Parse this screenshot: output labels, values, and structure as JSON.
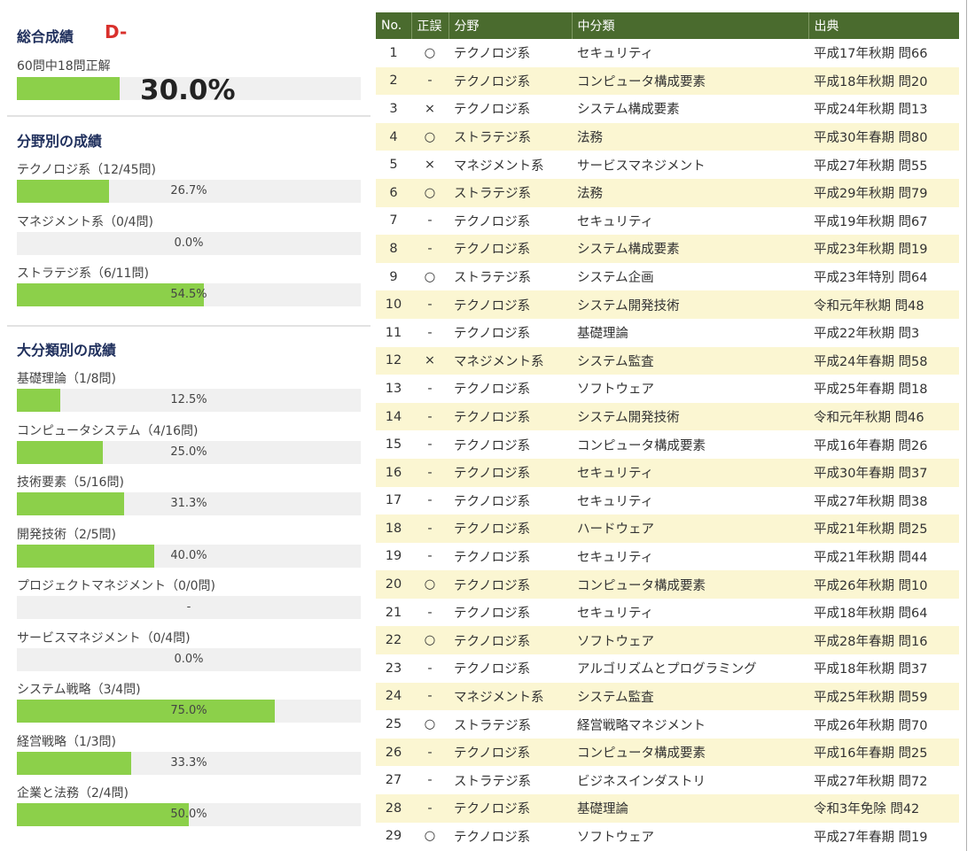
{
  "summary": {
    "title": "総合成績",
    "grade": "D-",
    "count_text": "60問中18問正解",
    "percent": "30.0%",
    "ratio": 0.3
  },
  "field_section": {
    "title": "分野別の成績",
    "items": [
      {
        "label": "テクノロジ系（12/45問)",
        "percent": "26.7%",
        "ratio": 0.267
      },
      {
        "label": "マネジメント系（0/4問)",
        "percent": "0.0%",
        "ratio": 0.0
      },
      {
        "label": "ストラテジ系（6/11問)",
        "percent": "54.5%",
        "ratio": 0.545
      }
    ]
  },
  "category_section": {
    "title": "大分類別の成績",
    "items": [
      {
        "label": "基礎理論（1/8問)",
        "percent": "12.5%",
        "ratio": 0.125
      },
      {
        "label": "コンピュータシステム（4/16問)",
        "percent": "25.0%",
        "ratio": 0.25
      },
      {
        "label": "技術要素（5/16問)",
        "percent": "31.3%",
        "ratio": 0.313
      },
      {
        "label": "開発技術（2/5問)",
        "percent": "40.0%",
        "ratio": 0.4
      },
      {
        "label": "プロジェクトマネジメント（0/0問)",
        "percent": "-",
        "ratio": 0.0
      },
      {
        "label": "サービスマネジメント（0/4問)",
        "percent": "0.0%",
        "ratio": 0.0
      },
      {
        "label": "システム戦略（3/4問)",
        "percent": "75.0%",
        "ratio": 0.75
      },
      {
        "label": "経営戦略（1/3問)",
        "percent": "33.3%",
        "ratio": 0.333
      },
      {
        "label": "企業と法務（2/4問)",
        "percent": "50.0%",
        "ratio": 0.5
      }
    ]
  },
  "table": {
    "headers": [
      "No.",
      "正誤",
      "分野",
      "中分類",
      "出典"
    ],
    "rows": [
      [
        "1",
        "○",
        "テクノロジ系",
        "セキュリティ",
        "平成17年秋期 問66"
      ],
      [
        "2",
        "-",
        "テクノロジ系",
        "コンピュータ構成要素",
        "平成18年秋期 問20"
      ],
      [
        "3",
        "×",
        "テクノロジ系",
        "システム構成要素",
        "平成24年秋期 問13"
      ],
      [
        "4",
        "○",
        "ストラテジ系",
        "法務",
        "平成30年春期 問80"
      ],
      [
        "5",
        "×",
        "マネジメント系",
        "サービスマネジメント",
        "平成27年秋期 問55"
      ],
      [
        "6",
        "○",
        "ストラテジ系",
        "法務",
        "平成29年秋期 問79"
      ],
      [
        "7",
        "-",
        "テクノロジ系",
        "セキュリティ",
        "平成19年秋期 問67"
      ],
      [
        "8",
        "-",
        "テクノロジ系",
        "システム構成要素",
        "平成23年秋期 問19"
      ],
      [
        "9",
        "○",
        "ストラテジ系",
        "システム企画",
        "平成23年特別 問64"
      ],
      [
        "10",
        "-",
        "テクノロジ系",
        "システム開発技術",
        "令和元年秋期 問48"
      ],
      [
        "11",
        "-",
        "テクノロジ系",
        "基礎理論",
        "平成22年秋期 問3"
      ],
      [
        "12",
        "×",
        "マネジメント系",
        "システム監査",
        "平成24年春期 問58"
      ],
      [
        "13",
        "-",
        "テクノロジ系",
        "ソフトウェア",
        "平成25年春期 問18"
      ],
      [
        "14",
        "-",
        "テクノロジ系",
        "システム開発技術",
        "令和元年秋期 問46"
      ],
      [
        "15",
        "-",
        "テクノロジ系",
        "コンピュータ構成要素",
        "平成16年春期 問26"
      ],
      [
        "16",
        "-",
        "テクノロジ系",
        "セキュリティ",
        "平成30年春期 問37"
      ],
      [
        "17",
        "-",
        "テクノロジ系",
        "セキュリティ",
        "平成27年秋期 問38"
      ],
      [
        "18",
        "-",
        "テクノロジ系",
        "ハードウェア",
        "平成21年秋期 問25"
      ],
      [
        "19",
        "-",
        "テクノロジ系",
        "セキュリティ",
        "平成21年秋期 問44"
      ],
      [
        "20",
        "○",
        "テクノロジ系",
        "コンピュータ構成要素",
        "平成26年秋期 問10"
      ],
      [
        "21",
        "-",
        "テクノロジ系",
        "セキュリティ",
        "平成18年秋期 問64"
      ],
      [
        "22",
        "○",
        "テクノロジ系",
        "ソフトウェア",
        "平成28年春期 問16"
      ],
      [
        "23",
        "-",
        "テクノロジ系",
        "アルゴリズムとプログラミング",
        "平成18年秋期 問37"
      ],
      [
        "24",
        "-",
        "マネジメント系",
        "システム監査",
        "平成25年秋期 問59"
      ],
      [
        "25",
        "○",
        "ストラテジ系",
        "経営戦略マネジメント",
        "平成26年秋期 問70"
      ],
      [
        "26",
        "-",
        "テクノロジ系",
        "コンピュータ構成要素",
        "平成16年春期 問25"
      ],
      [
        "27",
        "-",
        "ストラテジ系",
        "ビジネスインダストリ",
        "平成27年秋期 問72"
      ],
      [
        "28",
        "-",
        "テクノロジ系",
        "基礎理論",
        "令和3年免除 問42"
      ],
      [
        "29",
        "○",
        "テクノロジ系",
        "ソフトウェア",
        "平成27年春期 問19"
      ]
    ]
  },
  "colors": {
    "bar_fill": "#8cd04a",
    "bar_track": "#f0f0f0",
    "header_bg": "#4a6b2e",
    "stripe": "#fbf6d2",
    "heading": "#1f2f5c",
    "grade": "#d9302c"
  }
}
